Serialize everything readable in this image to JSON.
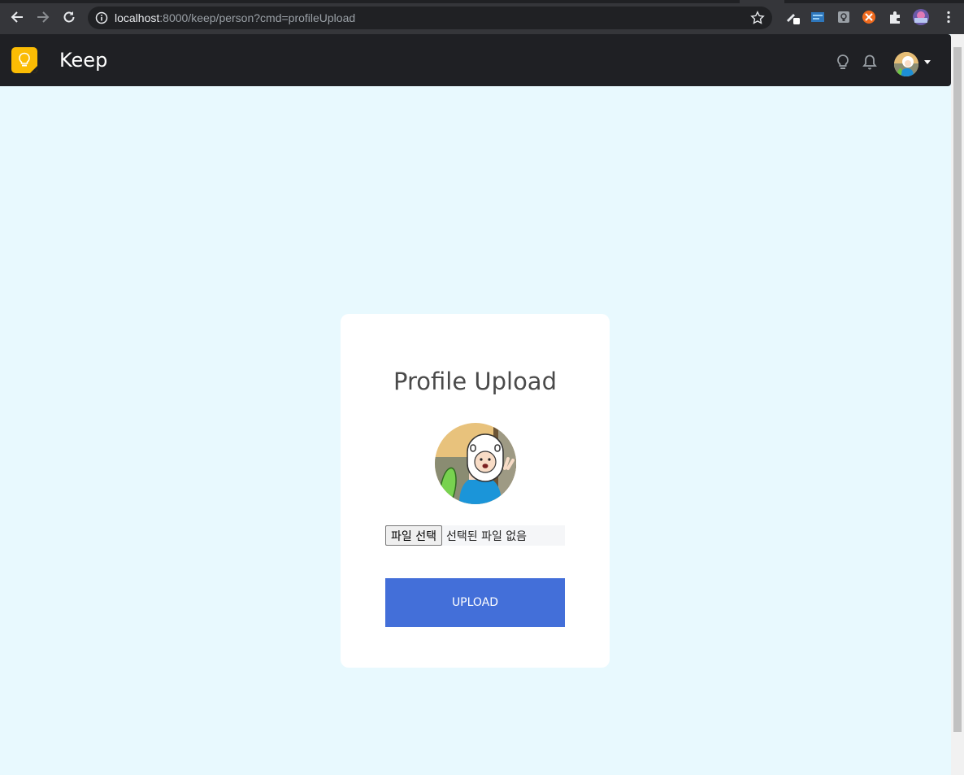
{
  "browser": {
    "url_host": "localhost",
    "url_rest": ":8000/keep/person?cmd=profileUpload"
  },
  "navbar": {
    "brand": "Keep",
    "icons": [
      "lightbulb-icon",
      "bell-icon"
    ]
  },
  "card": {
    "title": "Profile Upload",
    "file_button_label": "파일 선택",
    "file_status": "선택된 파일 없음",
    "upload_label": "UPLOAD"
  },
  "colors": {
    "page_bg": "#e8f9fe",
    "navbar_bg": "#1f2024",
    "logo": "#fbbc04",
    "upload_button": "#436fd9"
  }
}
